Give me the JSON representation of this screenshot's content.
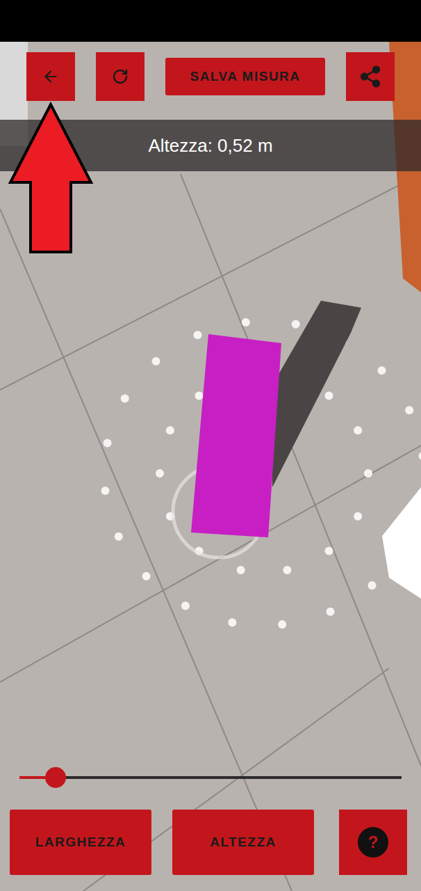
{
  "toolbar": {
    "save_button": "SALVA MISURA"
  },
  "measurement": {
    "label": "Altezza: 0,52 m"
  },
  "slider": {
    "level": 0.094
  },
  "mode_buttons": [
    {
      "label": "LARGHEZZA"
    },
    {
      "label": "ALTEZZA"
    }
  ],
  "help_button": {
    "label": "?"
  }
}
